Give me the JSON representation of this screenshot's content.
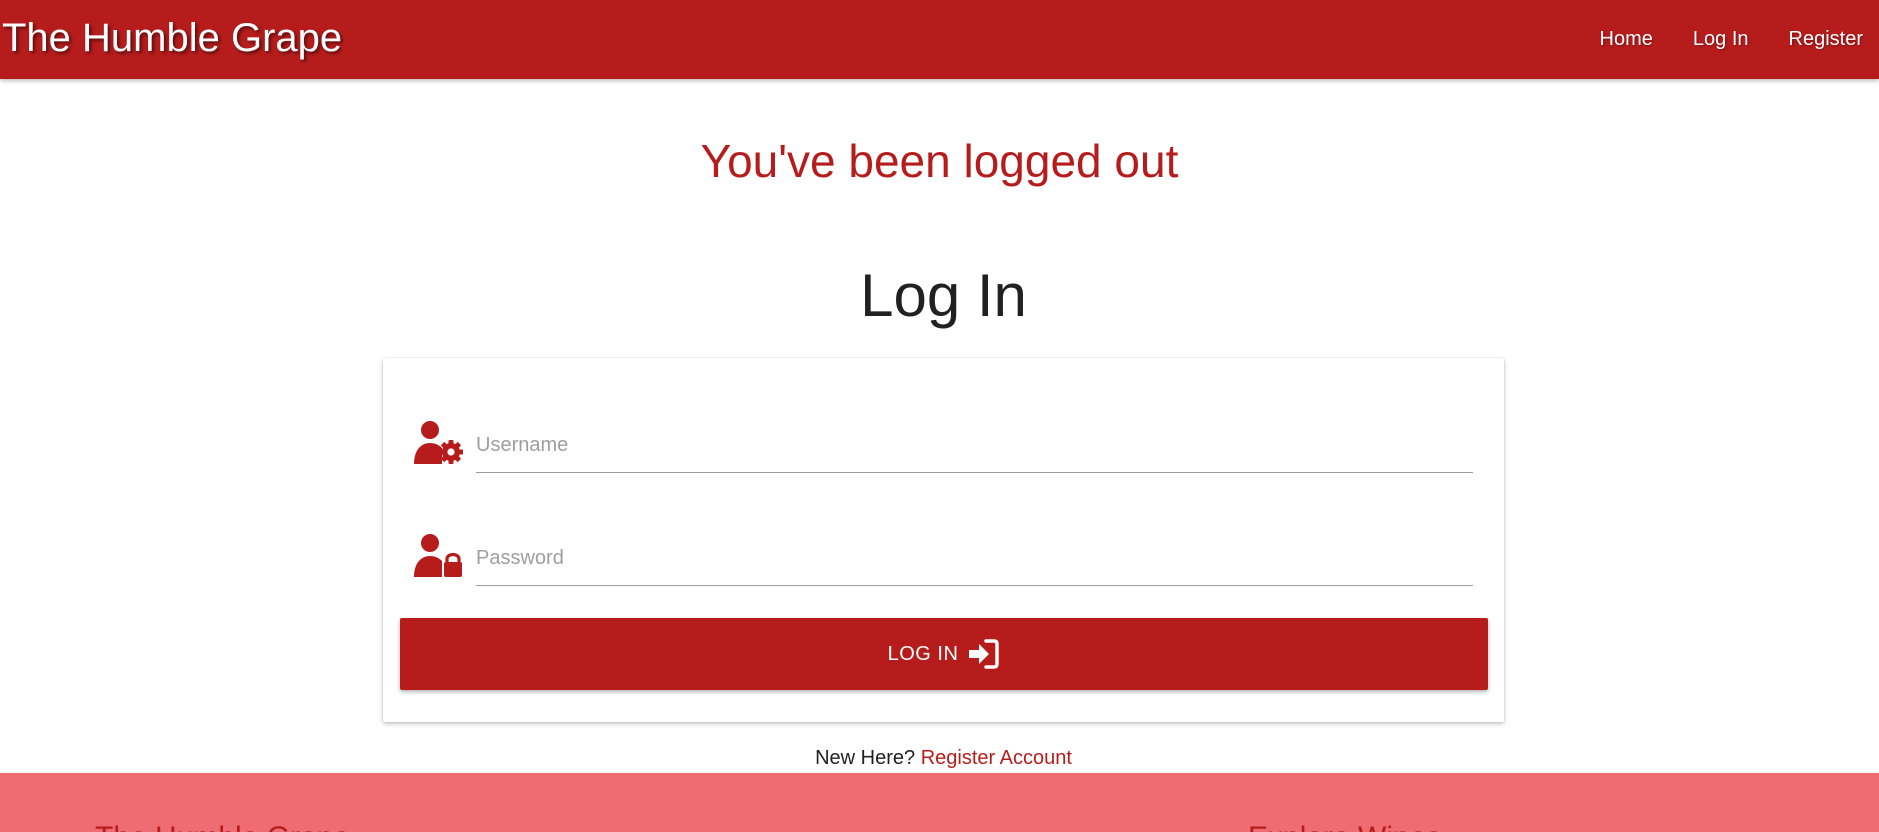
{
  "navbar": {
    "brand": "The Humble Grape",
    "links": [
      {
        "label": "Home"
      },
      {
        "label": "Log In"
      },
      {
        "label": "Register"
      }
    ]
  },
  "flash": {
    "message": "You've been logged out"
  },
  "login": {
    "title": "Log In",
    "username": {
      "placeholder": "Username",
      "value": "",
      "icon": "user-gear-icon"
    },
    "password": {
      "placeholder": "Password",
      "value": "",
      "icon": "user-lock-icon"
    },
    "submit_label": "LOG IN",
    "submit_icon": "sign-in-icon"
  },
  "register": {
    "prompt": "New Here?",
    "link": "Register Account"
  },
  "footer": {
    "left_heading": "The Humble Grape",
    "right_heading": "Explore Wines"
  },
  "colors": {
    "primary": "#b71c1c",
    "footer_bg": "#ef6c72",
    "text": "#212121",
    "placeholder": "#9e9e9e"
  }
}
